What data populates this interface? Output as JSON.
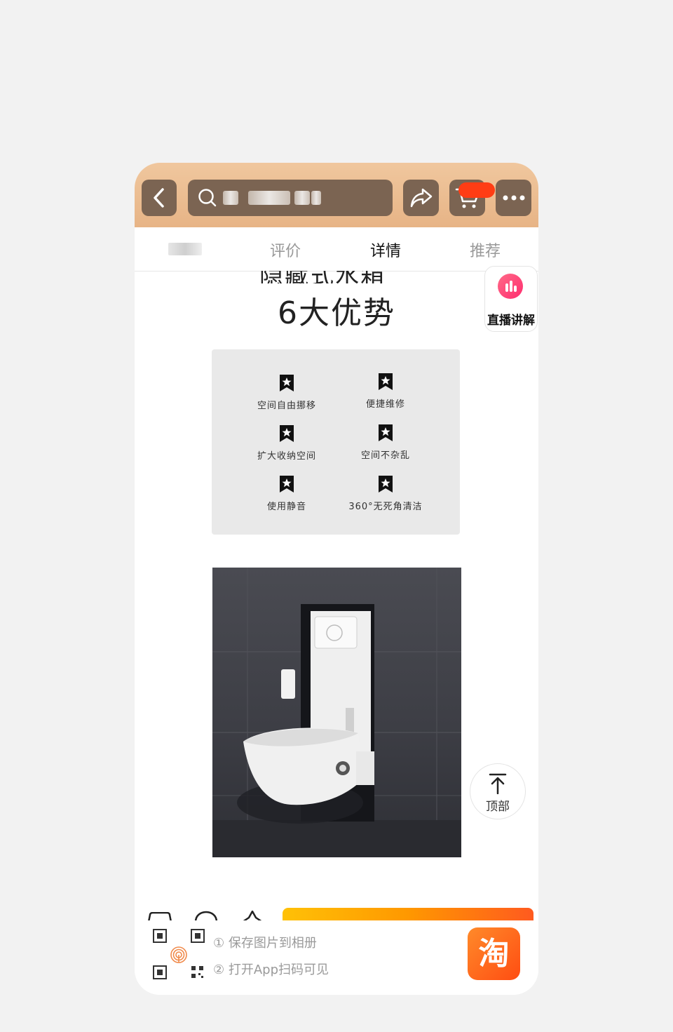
{
  "tabs": [
    "评价",
    "详情",
    "推荐"
  ],
  "active_tab": "详情",
  "headline": {
    "cut_line": "隐藏式水箱",
    "main": "6大优势"
  },
  "live_button": {
    "label": "直播讲解"
  },
  "features": [
    "空间自由挪移",
    "便捷维修",
    "扩大收纳空间",
    "空间不杂乱",
    "使用静音",
    "360°无死角清洁"
  ],
  "scroll_top": {
    "label": "顶部"
  },
  "promo": {
    "step1": "① 保存图片到相册",
    "step2": "② 打开App扫码可见",
    "app_glyph": "淘"
  },
  "colors": {
    "header_brown": "#7b6452",
    "badge_red": "#ff3d14",
    "live_pink": "#ff2d6f",
    "taobao_orange": "#ff5a1f"
  },
  "icons": [
    "back-icon",
    "search-icon",
    "share-icon",
    "cart-icon",
    "more-icon",
    "bookmark-star-icon",
    "arrow-up-icon",
    "qr-code-icon",
    "fingerprint-icon"
  ]
}
